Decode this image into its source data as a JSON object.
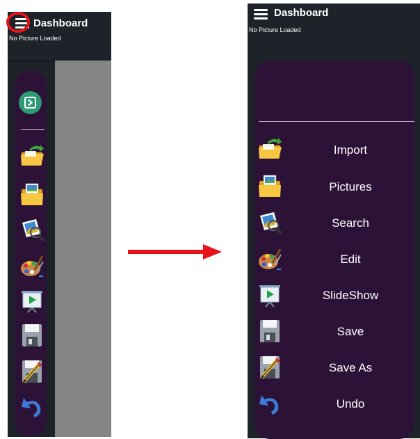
{
  "app": {
    "title": "Dashboard",
    "status": "No Picture Loaded"
  },
  "menu_items": [
    {
      "label": "Import",
      "icon": "import-folder-icon"
    },
    {
      "label": "Pictures",
      "icon": "pictures-folder-icon"
    },
    {
      "label": "Search",
      "icon": "search-picture-icon"
    },
    {
      "label": "Edit",
      "icon": "edit-palette-icon"
    },
    {
      "label": "SlideShow",
      "icon": "slideshow-icon"
    },
    {
      "label": "Save",
      "icon": "save-disk-icon"
    },
    {
      "label": "Save As",
      "icon": "save-as-icon"
    },
    {
      "label": "Undo",
      "icon": "undo-arrow-icon"
    }
  ],
  "colors": {
    "titlebar": "#1e2329",
    "menu_background": "#2d1238",
    "expand_button": "#2e9b77",
    "highlight": "#e8121a",
    "arrow": "#e8121a",
    "canvas": "#858585"
  }
}
